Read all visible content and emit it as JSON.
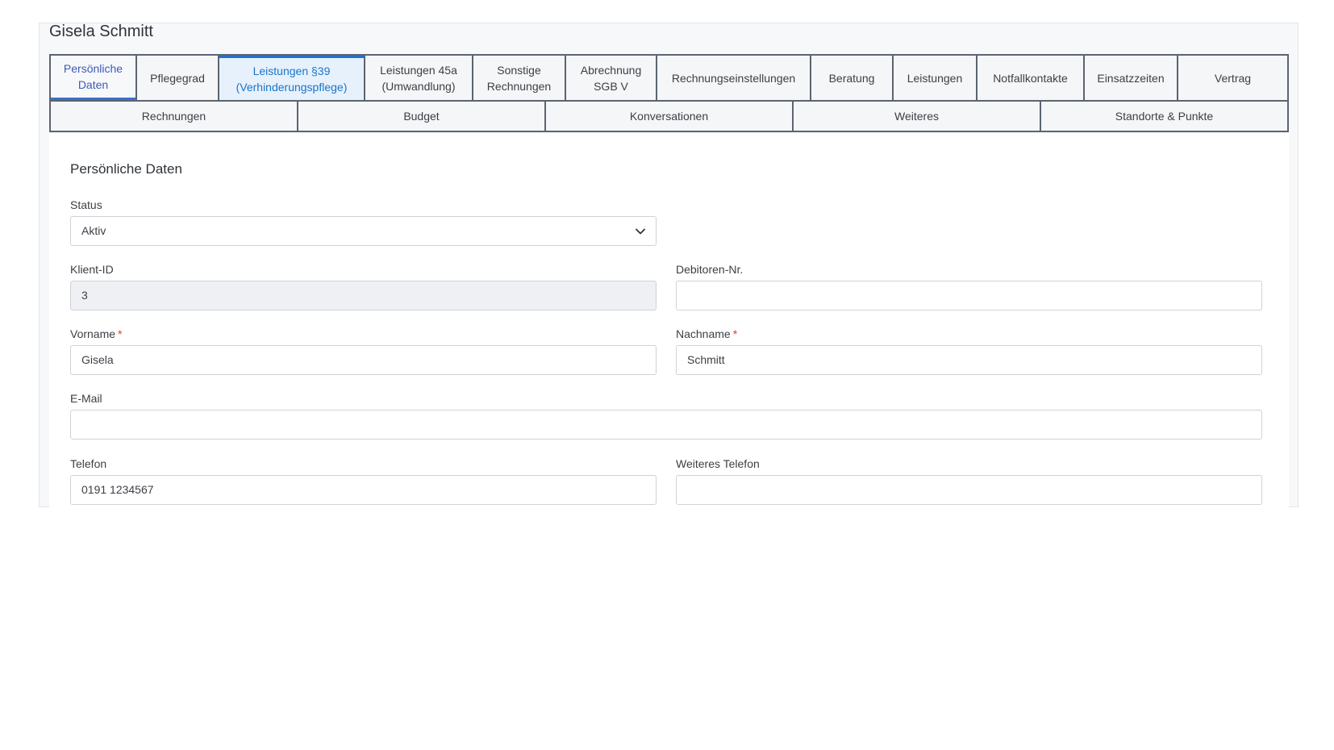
{
  "client_name": "Gisela Schmitt",
  "tabs_row1": [
    {
      "label": "Persönliche\nDaten",
      "state": "current"
    },
    {
      "label": "Pflegegrad",
      "state": ""
    },
    {
      "label": "Leistungen §39\n(Verhinderungspflege)",
      "state": "highlight"
    },
    {
      "label": "Leistungen 45a\n(Umwandlung)",
      "state": ""
    },
    {
      "label": "Sonstige\nRechnungen",
      "state": ""
    },
    {
      "label": "Abrechnung\nSGB V",
      "state": ""
    },
    {
      "label": "Rechnungseinstellungen",
      "state": ""
    },
    {
      "label": "Beratung",
      "state": ""
    },
    {
      "label": "Leistungen",
      "state": ""
    },
    {
      "label": "Notfallkontakte",
      "state": ""
    },
    {
      "label": "Einsatzzeiten",
      "state": ""
    },
    {
      "label": "Vertrag",
      "state": ""
    }
  ],
  "tabs_row2": [
    {
      "label": "Rechnungen"
    },
    {
      "label": "Budget"
    },
    {
      "label": "Konversationen"
    },
    {
      "label": "Weiteres"
    },
    {
      "label": "Standorte & Punkte"
    }
  ],
  "section_title": "Persönliche Daten",
  "form": {
    "status": {
      "label": "Status",
      "value": "Aktiv"
    },
    "client_id": {
      "label": "Klient-ID",
      "value": "3"
    },
    "debtor_no": {
      "label": "Debitoren-Nr.",
      "value": ""
    },
    "first_name": {
      "label": "Vorname",
      "required_mark": "*",
      "value": "Gisela"
    },
    "last_name": {
      "label": "Nachname",
      "required_mark": "*",
      "value": "Schmitt"
    },
    "email": {
      "label": "E-Mail",
      "value": ""
    },
    "phone": {
      "label": "Telefon",
      "value": "0191 1234567"
    },
    "phone2": {
      "label": "Weiteres Telefon",
      "value": ""
    }
  },
  "icons": {
    "status_dropdown": "chevron-down-icon"
  }
}
